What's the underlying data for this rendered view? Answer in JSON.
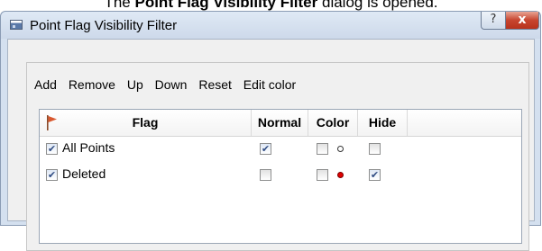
{
  "caption": {
    "prefix": "The ",
    "bold": "Point Flag Visibility Filter",
    "suffix": " dialog is opened."
  },
  "window": {
    "title": "Point Flag Visibility Filter",
    "help_label": "?",
    "close_label": "x"
  },
  "toolbar": {
    "add_label": "Add",
    "remove_label": "Remove",
    "up_label": "Up",
    "down_label": "Down",
    "reset_label": "Reset",
    "edit_color_label": "Edit color"
  },
  "table": {
    "columns": [
      "Flag",
      "Normal",
      "Color",
      "Hide"
    ],
    "rows": [
      {
        "name": "All Points",
        "selected": true,
        "normal": true,
        "color_checked": false,
        "color": "#ffffff",
        "hide": false
      },
      {
        "name": "Deleted",
        "selected": true,
        "normal": false,
        "color_checked": false,
        "color": "#e00000",
        "hide": true
      }
    ]
  },
  "colors": {
    "flag_icon": "#d9582f",
    "checkmark": "#2f4c84"
  }
}
